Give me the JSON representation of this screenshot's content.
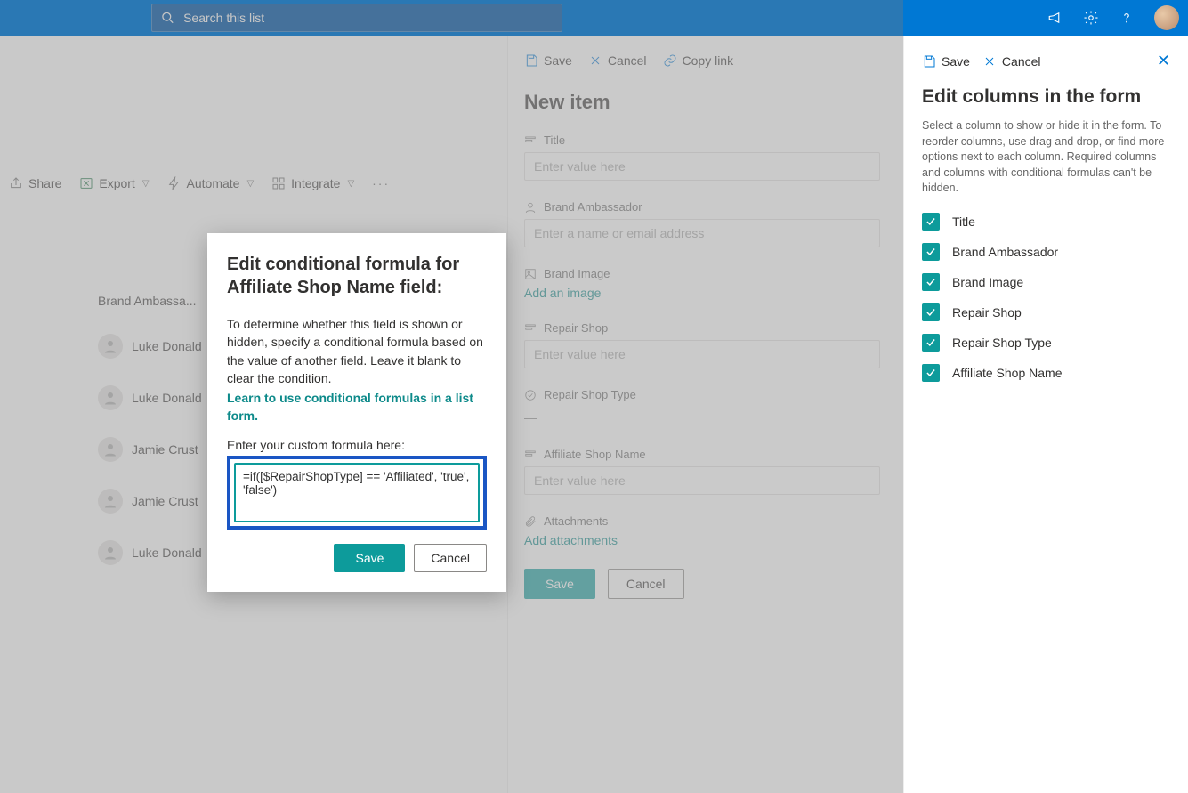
{
  "topbar": {
    "search_placeholder": "Search this list"
  },
  "commandbar": {
    "share": "Share",
    "export": "Export",
    "automate": "Automate",
    "integrate": "Integrate"
  },
  "list": {
    "column_header": "Brand Ambassa...",
    "rows": [
      "Luke Donald",
      "Luke Donald",
      "Jamie Crust",
      "Jamie Crust",
      "Luke Donald"
    ]
  },
  "newitem": {
    "actions": {
      "save": "Save",
      "cancel": "Cancel",
      "copylink": "Copy link"
    },
    "title": "New item",
    "fields": {
      "title_label": "Title",
      "title_ph": "Enter value here",
      "ambassador_label": "Brand Ambassador",
      "ambassador_ph": "Enter a name or email address",
      "brandimage_label": "Brand Image",
      "brandimage_link": "Add an image",
      "repairshop_label": "Repair Shop",
      "repairshop_ph": "Enter value here",
      "repairshoptype_label": "Repair Shop Type",
      "repairshoptype_val": "—",
      "affiliate_label": "Affiliate Shop Name",
      "affiliate_ph": "Enter value here",
      "attachments_label": "Attachments",
      "attachments_link": "Add attachments"
    },
    "buttons": {
      "save": "Save",
      "cancel": "Cancel"
    }
  },
  "editcols": {
    "actions": {
      "save": "Save",
      "cancel": "Cancel"
    },
    "title": "Edit columns in the form",
    "desc": "Select a column to show or hide it in the form. To reorder columns, use drag and drop, or find more options next to each column. Required columns and columns with conditional formulas can't be hidden.",
    "items": [
      "Title",
      "Brand Ambassador",
      "Brand Image",
      "Repair Shop",
      "Repair Shop Type",
      "Affiliate Shop Name"
    ]
  },
  "modal": {
    "title": "Edit conditional formula for Affiliate Shop Name field:",
    "text": "To determine whether this field is shown or hidden, specify a conditional formula based on the value of another field. Leave it blank to clear the condition.",
    "link": "Learn to use conditional formulas in a list form.",
    "field_label": "Enter your custom formula here:",
    "formula": "=if([$RepairShopType] == 'Affiliated', 'true', 'false')",
    "save": "Save",
    "cancel": "Cancel"
  }
}
